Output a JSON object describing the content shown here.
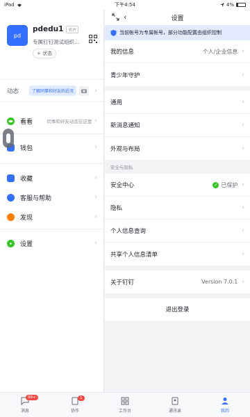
{
  "status_bar": {
    "device": "iPad",
    "time": "下午4:54",
    "battery": "4%"
  },
  "profile": {
    "avatar_text": "pd",
    "name": "pdedu1",
    "name_tag": "名片",
    "org": "专属钉钉测试组织...",
    "status_button": "+ 状态"
  },
  "dynamic": {
    "label": "动态",
    "chip": "了解同事和好友的近况"
  },
  "left_menu": {
    "watch": {
      "label": "看看",
      "hint": "同事和好友动态在这里"
    },
    "wallet": {
      "label": "钱包"
    },
    "favorites": {
      "label": "收藏"
    },
    "support": {
      "label": "客服与帮助"
    },
    "discover": {
      "label": "发现"
    },
    "settings": {
      "label": "设置"
    }
  },
  "settings_page": {
    "title": "设置",
    "notice": "当前帐号为专属帐号，部分功能配置由组织控制",
    "group1": [
      {
        "label": "我的信息",
        "value": "个人/企业信息"
      },
      {
        "label": "青少年守护",
        "value": ""
      }
    ],
    "group2": [
      {
        "label": "通用",
        "value": ""
      },
      {
        "label": "新消息通知",
        "value": ""
      },
      {
        "label": "外观与布局",
        "value": ""
      }
    ],
    "security_section_label": "安全与隐私",
    "security_center": {
      "label": "安全中心",
      "value": "已保护"
    },
    "group3": [
      {
        "label": "隐私",
        "value": ""
      },
      {
        "label": "个人信息查询",
        "value": ""
      },
      {
        "label": "共享个人信息清单",
        "value": ""
      }
    ],
    "about": {
      "label": "关于钉钉",
      "value": "Version 7.0.1"
    },
    "logout": "退出登录"
  },
  "tabbar": {
    "tabs": [
      {
        "label": "消息",
        "badge": "99+"
      },
      {
        "label": "协作",
        "badge": "1"
      },
      {
        "label": "工作台",
        "badge": ""
      },
      {
        "label": "通讯录",
        "badge": ""
      },
      {
        "label": "我的",
        "badge": ""
      }
    ],
    "active_index": 4
  },
  "colors": {
    "accent": "#3370ff",
    "watch": "#34c724",
    "wallet": "#3370ff",
    "favorites": "#3370ff",
    "support": "#3370ff",
    "discover": "#ff7d00",
    "settings": "#34c724",
    "badge": "#f54a45"
  }
}
